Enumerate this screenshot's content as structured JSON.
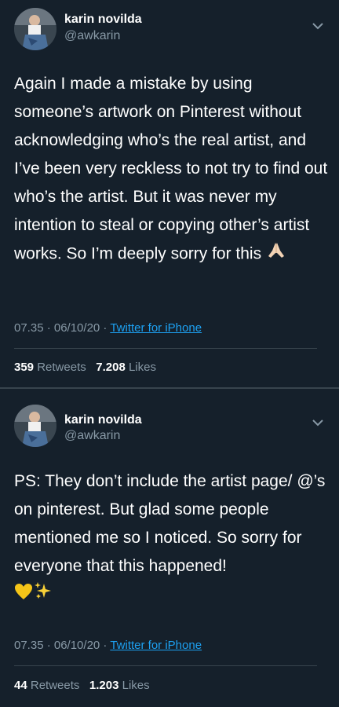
{
  "tweets": [
    {
      "name": "karin novilda",
      "handle": "@awkarin",
      "text": "Again I made a mistake by using someone’s artwork on Pinterest without acknowledging who’s the real artist, and I’ve been very reckless to not try to find out who’s the artist. But it was never my intention to steal or copying other’s artist works. So I’m deeply sorry for this",
      "emoji": "folded-hands",
      "time": "07.35 · 06/10/20 · ",
      "source": "Twitter for iPhone",
      "retweets_count": "359",
      "retweets_label": "Retweets",
      "likes_count": "7.208",
      "likes_label": "Likes"
    },
    {
      "name": "karin novilda",
      "handle": "@awkarin",
      "text": "PS: They don’t include the artist page/ @’s on pinterest. But glad some people mentioned me so I noticed. So sorry for everyone that this happened!",
      "emoji": "yellow-heart sparkles",
      "time": "07.35 · 06/10/20 · ",
      "source": "Twitter for iPhone",
      "retweets_count": "44",
      "retweets_label": "Retweets",
      "likes_count": "1.203",
      "likes_label": "Likes"
    }
  ],
  "colors": {
    "background": "#15202b",
    "secondary_text": "#8899a6",
    "link": "#1da1f2",
    "divider": "#38444d"
  }
}
